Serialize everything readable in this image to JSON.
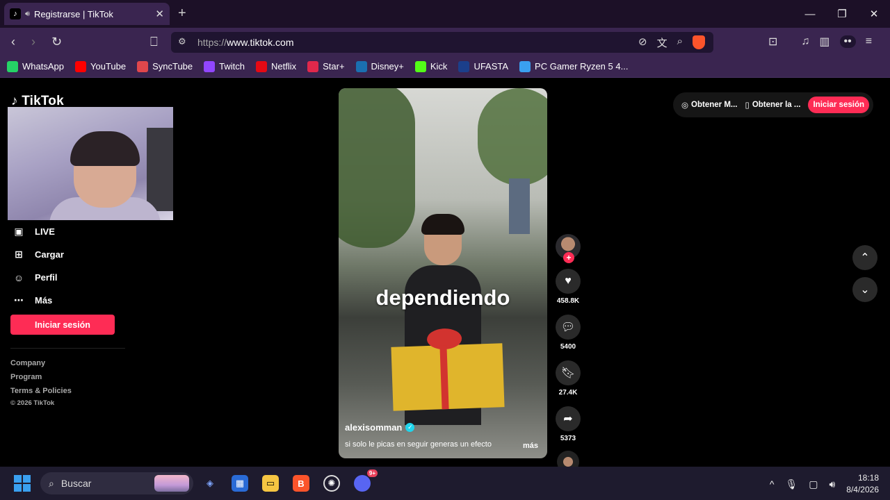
{
  "browser": {
    "tab_title": "Registrarse | TikTok",
    "url_protocol": "https://",
    "url_host": "www.tiktok.com",
    "accent": "#fb542b"
  },
  "bookmarks": [
    {
      "label": "WhatsApp",
      "icon": "whatsapp-icon",
      "color": "#25d366"
    },
    {
      "label": "YouTube",
      "icon": "youtube-icon",
      "color": "#ff0000"
    },
    {
      "label": "SyncTube",
      "icon": "synctube-icon",
      "color": "#e0474c"
    },
    {
      "label": "Twitch",
      "icon": "twitch-icon",
      "color": "#9146ff"
    },
    {
      "label": "Netflix",
      "icon": "netflix-icon",
      "color": "#e50914"
    },
    {
      "label": "Star+",
      "icon": "star-icon",
      "color": "#e0284b"
    },
    {
      "label": "Disney+",
      "icon": "disney-icon",
      "color": "#1a6fb0"
    },
    {
      "label": "Kick",
      "icon": "kick-icon",
      "color": "#53fc18"
    },
    {
      "label": "UFASTA",
      "icon": "ufasta-icon",
      "color": "#1b3f8b"
    },
    {
      "label": "PC Gamer Ryzen 5 4...",
      "icon": "pc-icon",
      "color": "#3aa0f0"
    }
  ],
  "sidebar": {
    "logo": "TikTok",
    "items": [
      {
        "label": "LIVE",
        "icon": "live-icon"
      },
      {
        "label": "Cargar",
        "icon": "upload-icon"
      },
      {
        "label": "Perfil",
        "icon": "profile-icon"
      },
      {
        "label": "Más",
        "icon": "more-icon"
      }
    ],
    "login_label": "Iniciar sesión",
    "footer": {
      "company": "Company",
      "program": "Program",
      "terms": "Terms & Policies",
      "copyright": "© 2026 TikTok"
    }
  },
  "topbar": {
    "get_coins": "Obtener M...",
    "get_app": "Obtener la ...",
    "login_label": "Iniciar sesión"
  },
  "video": {
    "overlay_text": "dependiendo",
    "author": "alexisomman",
    "description": "si solo le picas en seguir generas un efecto",
    "more_label": "más",
    "likes": "458.8K",
    "comments": "5400",
    "saves": "27.4K",
    "shares": "5373"
  },
  "taskbar": {
    "search_placeholder": "Buscar",
    "time": "18:18",
    "date": "8/4/2026",
    "discord_badge": "9+"
  },
  "colors": {
    "brand_pink": "#fe2c55",
    "titlebar": "#1c1027",
    "toolbar": "#3a2550"
  }
}
